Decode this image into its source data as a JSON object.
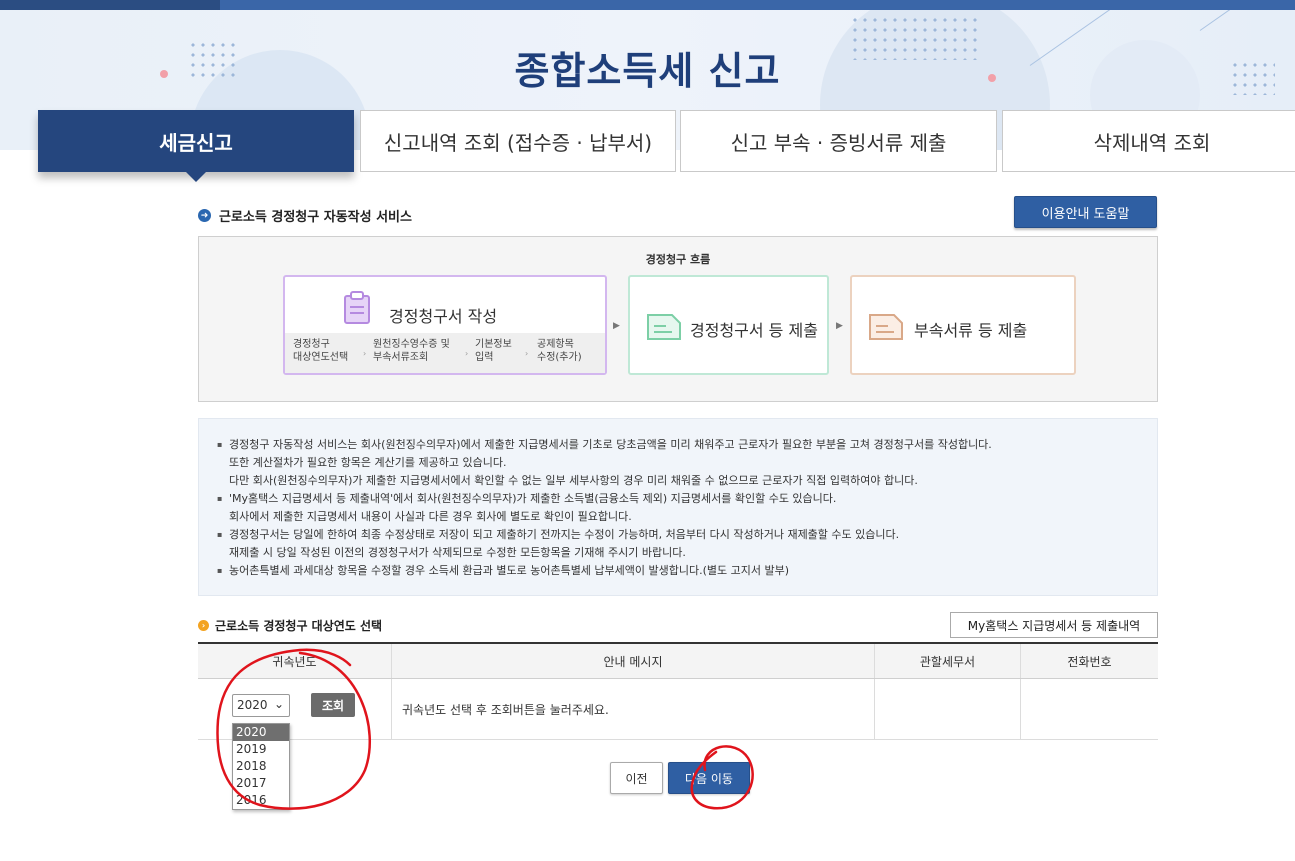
{
  "banner": {
    "title": "종합소득세 신고"
  },
  "tabs": [
    {
      "label": "세금신고",
      "active": true
    },
    {
      "label": "신고내역 조회 (접수증 · 납부서)",
      "active": false
    },
    {
      "label": "신고 부속 · 증빙서류 제출",
      "active": false
    },
    {
      "label": "삭제내역 조회",
      "active": false
    }
  ],
  "service": {
    "heading": "근로소득 경정청구 자동작성 서비스",
    "help_button": "이용안내 도움말"
  },
  "flow": {
    "title": "경정청구 흐름",
    "steps": [
      {
        "label": "경정청구서 작성"
      },
      {
        "label": "경정청구서 등 제출"
      },
      {
        "label": "부속서류 등 제출"
      }
    ],
    "substeps": [
      {
        "line1": "경정청구",
        "line2": "대상연도선택"
      },
      {
        "line1": "원천징수영수증 및",
        "line2": "부속서류조회"
      },
      {
        "line1": "기본정보",
        "line2": "입력"
      },
      {
        "line1": "공제항목",
        "line2": "수정(추가)"
      }
    ]
  },
  "notes": [
    {
      "lines": [
        "경정청구 자동작성 서비스는 회사(원천징수의무자)에서 제출한 지급명세서를 기초로 당초금액을 미리 채워주고 근로자가 필요한 부분을 고쳐 경정청구서를 작성합니다.",
        "또한 계산절차가 필요한 항목은 계산기를 제공하고 있습니다.",
        "다만 회사(원천징수의무자)가 제출한 지급명세서에서 확인할 수 없는 일부 세부사항의 경우 미리 채워줄 수 없으므로 근로자가 직접 입력하여야 합니다."
      ]
    },
    {
      "lines": [
        "'My홈택스 지급명세서 등 제출내역'에서 회사(원천징수의무자)가 제출한 소득별(금융소득 제외) 지급명세서를 확인할 수도 있습니다.",
        "회사에서 제출한 지급명세서 내용이 사실과 다른 경우 회사에 별도로 확인이 필요합니다."
      ]
    },
    {
      "lines": [
        "경정청구서는 당일에 한하여 최종 수정상태로 저장이 되고 제출하기 전까지는 수정이 가능하며, 처음부터 다시 작성하거나 재제출할 수도 있습니다.",
        "재제출 시 당일 작성된 이전의 경정청구서가 삭제되므로 수정한 모든항목을 기재해 주시기 바랍니다."
      ]
    },
    {
      "lines": [
        "농어촌특별세 과세대상 항목을 수정할 경우 소득세 환급과 별도로 농어촌특별세 납부세액이 발생합니다.(별도 고지서 발부)"
      ]
    }
  ],
  "year_section": {
    "heading": "근로소득 경정청구 대상연도 선택",
    "mytax_button": "My홈택스 지급명세서 등 제출내역"
  },
  "table": {
    "headers": [
      "귀속년도",
      "안내 메시지",
      "관할세무서",
      "전화번호"
    ],
    "message": "귀속년도 선택 후 조회버튼을 눌러주세요.",
    "tax_office": "",
    "phone": ""
  },
  "year_select": {
    "value": "2020",
    "options": [
      "2020",
      "2019",
      "2018",
      "2017",
      "2016"
    ]
  },
  "query_button": "조회",
  "buttons": {
    "prev": "이전",
    "next": "다음 이동"
  },
  "colors": {
    "primary": "#25467e",
    "button_blue": "#2f5fa3",
    "annotation": "#e0141c"
  }
}
